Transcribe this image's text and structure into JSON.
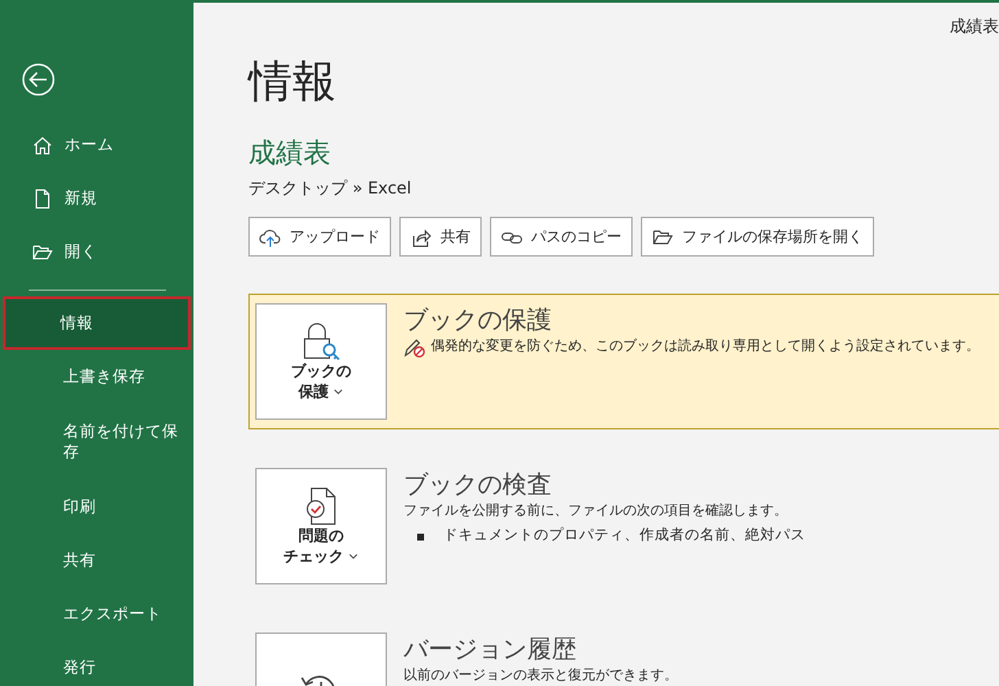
{
  "window": {
    "title": "成績表"
  },
  "sidebar": {
    "items": [
      {
        "label": "ホーム",
        "kind": "home",
        "selected": false
      },
      {
        "label": "新規",
        "kind": "new",
        "selected": false
      },
      {
        "label": "開く",
        "kind": "open",
        "selected": false
      },
      {
        "label": "情報",
        "kind": "plain",
        "selected": true
      },
      {
        "label": "上書き保存",
        "kind": "plain",
        "selected": false
      },
      {
        "label": "名前を付けて保存",
        "kind": "plain",
        "selected": false
      },
      {
        "label": "印刷",
        "kind": "plain",
        "selected": false
      },
      {
        "label": "共有",
        "kind": "plain",
        "selected": false
      },
      {
        "label": "エクスポート",
        "kind": "plain",
        "selected": false
      },
      {
        "label": "発行",
        "kind": "plain",
        "selected": false
      }
    ]
  },
  "page_title": "情報",
  "file": {
    "name": "成績表",
    "path": "デスクトップ » Excel"
  },
  "actions": [
    {
      "label": "アップロード",
      "kind": "upload"
    },
    {
      "label": "共有",
      "kind": "share"
    },
    {
      "label": "パスのコピー",
      "kind": "link"
    },
    {
      "label": "ファイルの保存場所を開く",
      "kind": "folder"
    }
  ],
  "sections": [
    {
      "kind": "protect",
      "highlighted": true,
      "button": [
        "ブックの",
        "保護"
      ],
      "title": "ブックの保護",
      "description": "偶発的な変更を防ぐため、このブックは読み取り専用として開くよう設定されています。",
      "warning": true
    },
    {
      "kind": "inspect",
      "highlighted": false,
      "button": [
        "問題の",
        "チェック"
      ],
      "title": "ブックの検査",
      "description": "ファイルを公開する前に、ファイルの次の項目を確認します。",
      "warning": false,
      "bullets": [
        "ドキュメントのプロパティ、作成者の名前、絶対パス"
      ]
    },
    {
      "kind": "history",
      "highlighted": false,
      "title": "バージョン履歴",
      "description": "以前のバージョンの表示と復元ができます。",
      "warning": false
    }
  ]
}
